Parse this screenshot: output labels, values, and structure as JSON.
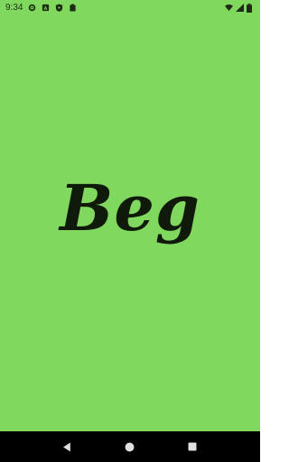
{
  "status_bar": {
    "time": "9:34",
    "left_icons": [
      "gear-icon",
      "sim-card-a-icon",
      "play-protect-icon",
      "clipboard-icon"
    ],
    "right_icons": [
      "wifi-icon",
      "cell-signal-icon",
      "battery-icon"
    ]
  },
  "splash": {
    "title": "Beg",
    "background_color": "#80d95e",
    "text_color": "#0f1a0a"
  },
  "nav_bar": {
    "buttons": [
      "back-button",
      "home-button",
      "recents-button"
    ]
  }
}
